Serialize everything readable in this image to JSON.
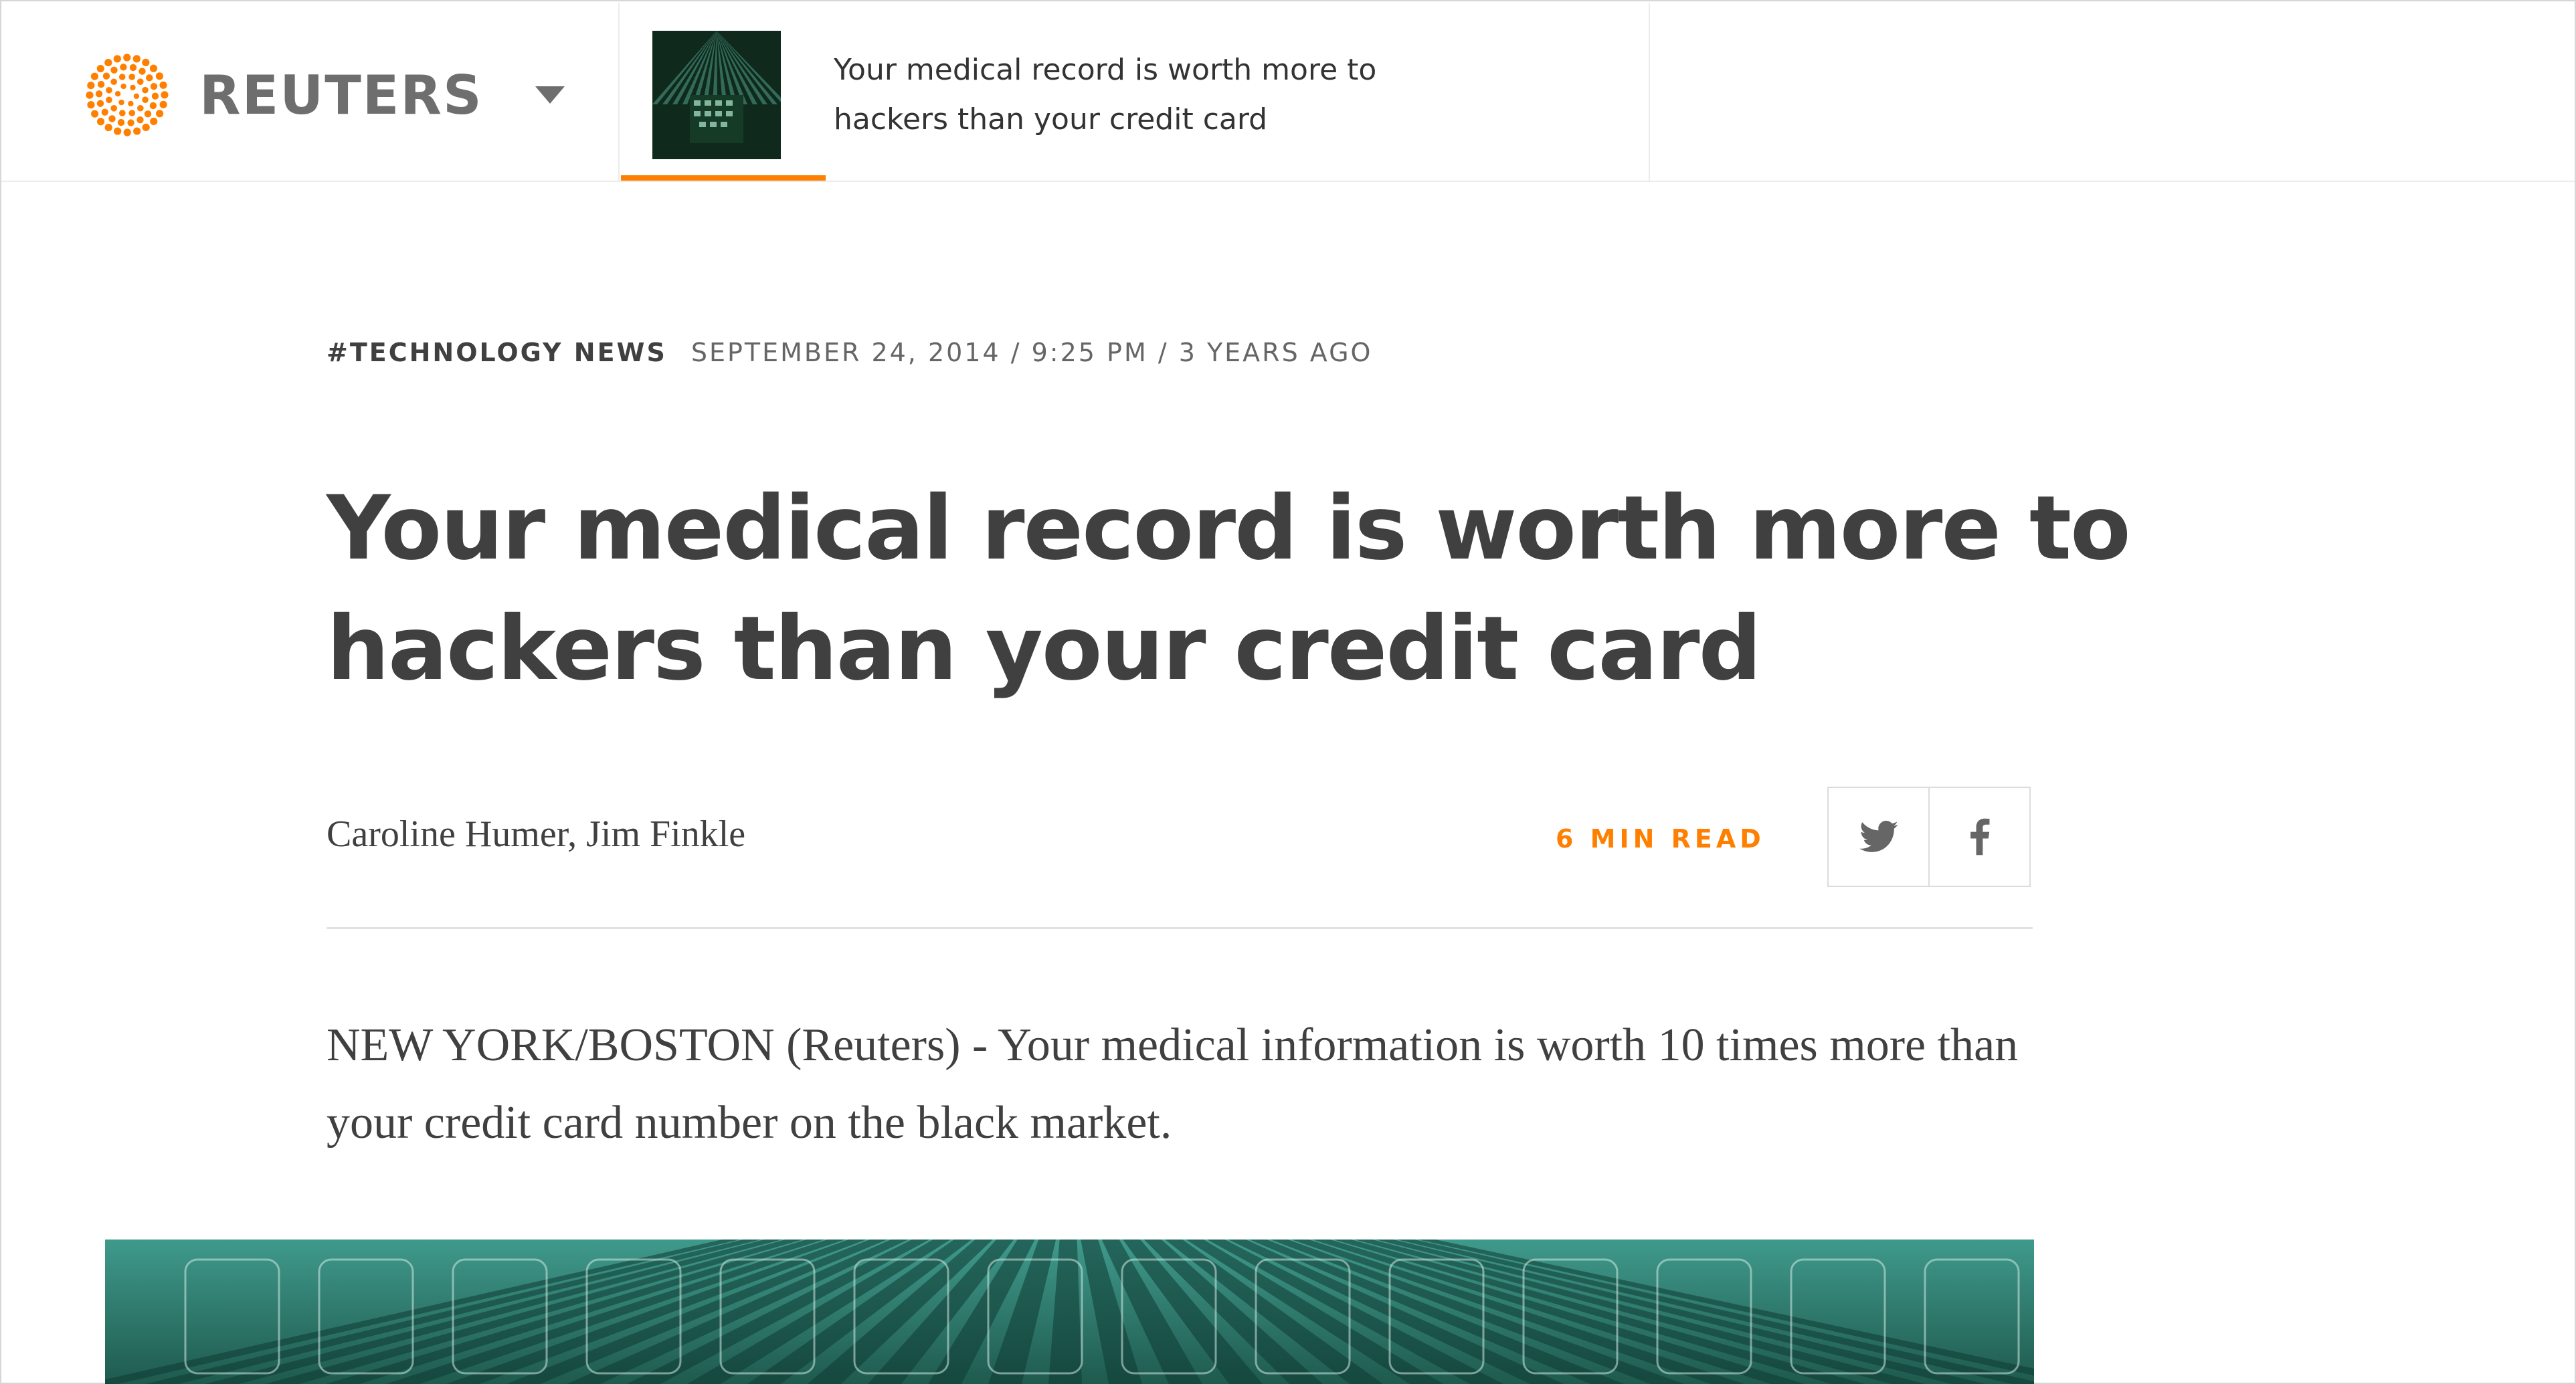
{
  "header": {
    "logo_text": "REUTERS",
    "brand_color": "#ff8000",
    "menu_icon": "chevron-down-icon",
    "active_story": {
      "title": "Your medical record is worth more to hackers than your credit card",
      "thumbnail": "keyboard-image"
    }
  },
  "article": {
    "section_tag": "#TECHNOLOGY NEWS",
    "timestamp": "SEPTEMBER 24, 2014 / 9:25 PM / 3 YEARS AGO",
    "headline": "Your medical record is worth more to hackers than your credit card",
    "byline": "Caroline Humer, Jim Finkle",
    "read_time": "6 MIN READ",
    "share": {
      "twitter_icon": "twitter-icon",
      "facebook_icon": "facebook-icon"
    },
    "lede": "NEW YORK/BOSTON (Reuters) - Your medical information is worth 10 times more than your credit card number on the black market.",
    "hero_image": "keyboard-image"
  }
}
